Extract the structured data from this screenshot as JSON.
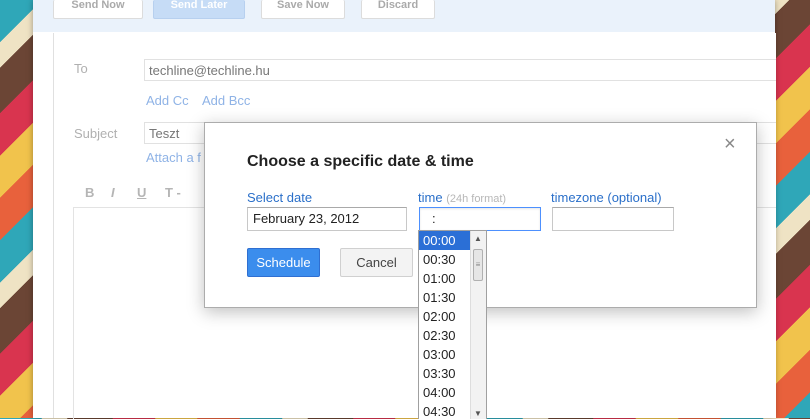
{
  "toolbar": {
    "send_now": "Send Now",
    "send_later": "Send Later",
    "save_now": "Save Now",
    "discard": "Discard"
  },
  "compose": {
    "to_label": "To",
    "to_value": "techline@techline.hu",
    "add_cc": "Add Cc",
    "add_bcc": "Add Bcc",
    "subject_label": "Subject",
    "subject_value": "Teszt",
    "attach": "Attach a f",
    "format_bold": "B",
    "format_italic": "I",
    "format_underline": "U",
    "format_text": "T -"
  },
  "dialog": {
    "close": "×",
    "title": "Choose a specific date & time",
    "date_label": "Select date",
    "date_value": "February 23, 2012",
    "time_label": "time",
    "time_hint": "(24h format)",
    "time_value": ":",
    "timezone_label": "timezone (optional)",
    "timezone_value": "",
    "schedule": "Schedule",
    "cancel": "Cancel"
  },
  "time_options": [
    "00:00",
    "00:30",
    "01:00",
    "01:30",
    "02:00",
    "02:30",
    "03:00",
    "03:30",
    "04:00",
    "04:30"
  ],
  "selected_time": "00:00",
  "colors": {
    "accent": "#3b8ded",
    "link": "#2a6fc9",
    "selection": "#2b6fd6"
  }
}
